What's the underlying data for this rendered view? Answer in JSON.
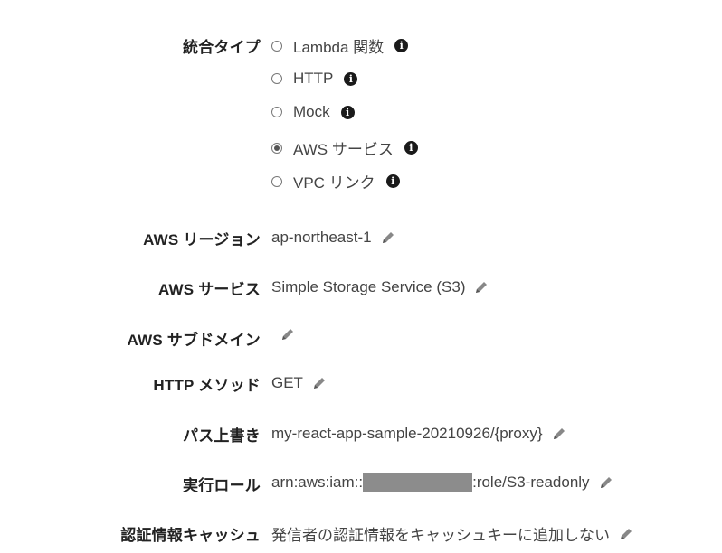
{
  "integration_type": {
    "label": "統合タイプ",
    "options": [
      {
        "label": "Lambda 関数",
        "checked": false
      },
      {
        "label": "HTTP",
        "checked": false
      },
      {
        "label": "Mock",
        "checked": false
      },
      {
        "label": "AWS サービス",
        "checked": true
      },
      {
        "label": "VPC リンク",
        "checked": false
      }
    ]
  },
  "info_icon": "i",
  "fields": {
    "aws_region": {
      "label": "AWS リージョン",
      "value": "ap-northeast-1"
    },
    "aws_service": {
      "label": "AWS サービス",
      "value": "Simple Storage Service (S3)"
    },
    "aws_subdomain": {
      "label": "AWS サブドメイン",
      "value": ""
    },
    "http_method": {
      "label": "HTTP メソッド",
      "value": "GET"
    },
    "path_override": {
      "label": "パス上書き",
      "value": "my-react-app-sample-20210926/{proxy}"
    },
    "execution_role": {
      "label": "実行ロール",
      "value_prefix": "arn:aws:iam::",
      "value_suffix": ":role/S3-readonly"
    },
    "credentials_cache": {
      "label": "認証情報キャッシュ",
      "value": "発信者の認証情報をキャッシュキーに追加しない"
    }
  }
}
